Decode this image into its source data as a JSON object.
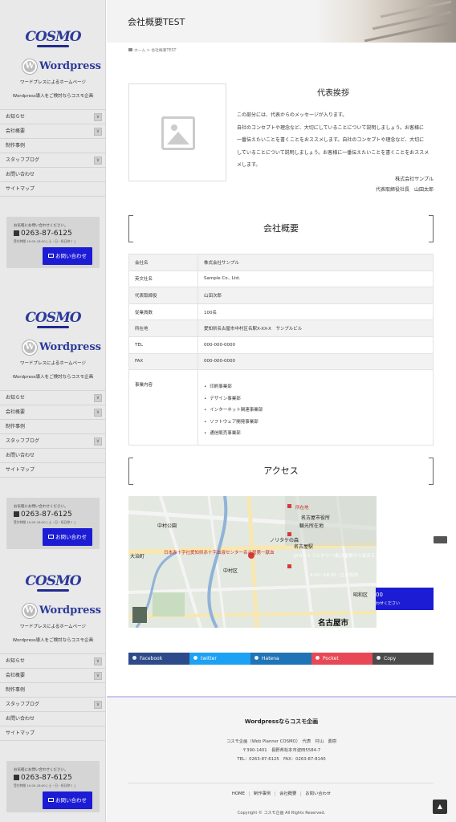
{
  "sidebar": {
    "logo_text": "COSMO",
    "wp_letter": "W",
    "wp_text": "Wordpress",
    "wp_sub": "ワードプレスによるホームページ",
    "tagline": "Wordpress導入をご検討ならコスモ企画",
    "nav": [
      {
        "label": "お知らせ",
        "toggle": "∨"
      },
      {
        "label": "会社概要",
        "toggle": "∨"
      },
      {
        "label": "制作事例"
      },
      {
        "label": "スタッフブログ",
        "toggle": "∨"
      },
      {
        "label": "お問い合わせ"
      },
      {
        "label": "サイトマップ"
      }
    ],
    "contact": {
      "top_text": "お気軽にお問い合わせください。",
      "phone": "0263-87-6125",
      "hours": "受付時間 10:00-18:00 [ 土・日・祝日除く ]",
      "button": "お問い合わせ"
    }
  },
  "header": {
    "page_title": "会社概要TEST"
  },
  "breadcrumb": {
    "home": "ホーム",
    "separator": ">",
    "current": "会社概要TEST"
  },
  "greeting": {
    "title": "代表挨拶",
    "lines": [
      "この部分には、代表からのメッセージが入ります。",
      "自社のコンセプトや理念など、大切にしていることについて説明しましょう。お客様に",
      "一番伝えたいことを書くことをおススメします。自社のコンセプトや理念など、大切に",
      "していることについて説明しましょう。お客様に一番伝えたいことを書くことをおススメ",
      "メします。"
    ],
    "sign_company": "株式会社サンプル",
    "sign_person": "代表取締役社長　山田太郎"
  },
  "company": {
    "heading": "会社概要",
    "rows": [
      {
        "key": "会社名",
        "value": "株式会社サンプル"
      },
      {
        "key": "英文社名",
        "value": "Sample Co., Ltd."
      },
      {
        "key": "代表取締役",
        "value": "山田次郎"
      },
      {
        "key": "従業員数",
        "value": "100名"
      },
      {
        "key": "所在地",
        "value": "愛知県名古屋市中村区名駅X-XX-X　サンプルビル"
      },
      {
        "key": "TEL",
        "value": "000-000-0000"
      },
      {
        "key": "FAX",
        "value": "000-000-0000"
      }
    ],
    "business_key": "事業内容",
    "business_items": [
      "印刷事業部",
      "デザイン事業部",
      "インターネット関連事業部",
      "ソフトウェア開発事業部",
      "通信販売事業部"
    ]
  },
  "access": {
    "heading": "アクセス",
    "map_labels": {
      "city": "名古屋市",
      "kanko": "観光所在地",
      "station_top": "名古屋駅",
      "venue": "日本赤十字社愛知県赤十字血液センター名古屋第一献血",
      "ward": "中村区",
      "daisho": "大治町",
      "shop": "ノリタケの森",
      "poi1": "中村公園",
      "rail": "JRセントラルタワーズ",
      "poi2": "所在地",
      "poi3": "名古屋市役所",
      "poi4": "昭和区",
      "walk": "名古屋駅から徒歩５分",
      "hours": "9:00~18:00（土日祝休"
    }
  },
  "overlay": {
    "label1": "00",
    "label2": "わせください"
  },
  "share": [
    {
      "label": "Facebook",
      "color": "#2d4a8a"
    },
    {
      "label": "twitter",
      "color": "#1da1f2"
    },
    {
      "label": "Hatena",
      "color": "#1f73b7"
    },
    {
      "label": "Pocket",
      "color": "#e84855"
    },
    {
      "label": "Copy",
      "color": "#4b4b4b"
    }
  ],
  "footer": {
    "title": "Wordpressならコスモ企画",
    "line1": "コスモ企画（Web Planner COSMO）　代表　村山　勇樹",
    "line2": "〒390-1401　長野県松本市波田5584-7",
    "line3": "TEL：0263-87-6125　FAX：0263-87-8140",
    "nav": [
      "HOME",
      "制作事例",
      "会社概要",
      "お問い合わせ"
    ],
    "copyright": "Copyright © コスモ企画 All Rights Reserved."
  },
  "colors": {
    "accent": "#1c1cd4",
    "brand_navy": "#2b3a9a",
    "sidebar_bg": "#e9e9e9"
  }
}
